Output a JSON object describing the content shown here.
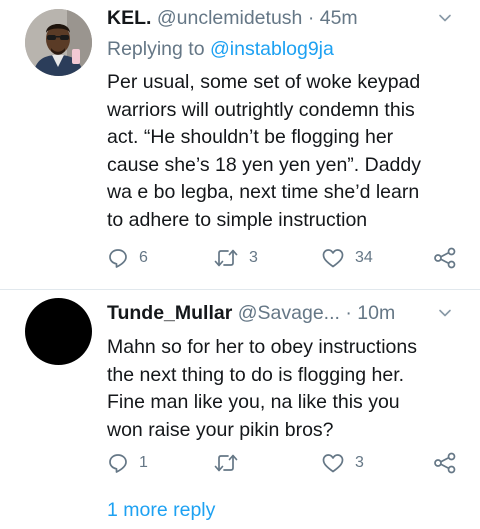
{
  "colors": {
    "accent": "#1da1f2",
    "secondary_text": "#657786",
    "text": "#14171a",
    "divider": "#e1e8ed"
  },
  "tweets": [
    {
      "name": "KEL.",
      "handle": "@unclemidetush",
      "separator": "·",
      "time": "45m",
      "replying_prefix": "Replying to",
      "replying_to": "@instablog9ja",
      "body_lines": [
        "Per usual, some set of woke keypad",
        "warriors will outrightly condemn this",
        "act. “He shouldn’t be flogging her",
        "cause she’s 18 yen yen yen”. Daddy",
        "wa e bo legba, next time she’d learn",
        "to adhere to simple instruction"
      ],
      "actions": {
        "replies": "6",
        "retweets": "3",
        "likes": "34"
      },
      "icons": [
        "reply-icon",
        "retweet-icon",
        "heart-icon",
        "share-icon",
        "chevron-down-icon"
      ]
    },
    {
      "name": "Tunde_Mullar",
      "handle": "@Savage...",
      "separator": "·",
      "time": "10m",
      "body_lines": [
        "Mahn so for her to obey instructions",
        "the next thing to do is flogging her.",
        "Fine man like you, na like this you",
        "won raise your pikin bros?"
      ],
      "actions": {
        "replies": "1",
        "retweets": "",
        "likes": "3"
      },
      "icons": [
        "reply-icon",
        "retweet-icon",
        "heart-icon",
        "share-icon",
        "chevron-down-icon"
      ]
    }
  ],
  "more_replies_label": "1 more reply"
}
